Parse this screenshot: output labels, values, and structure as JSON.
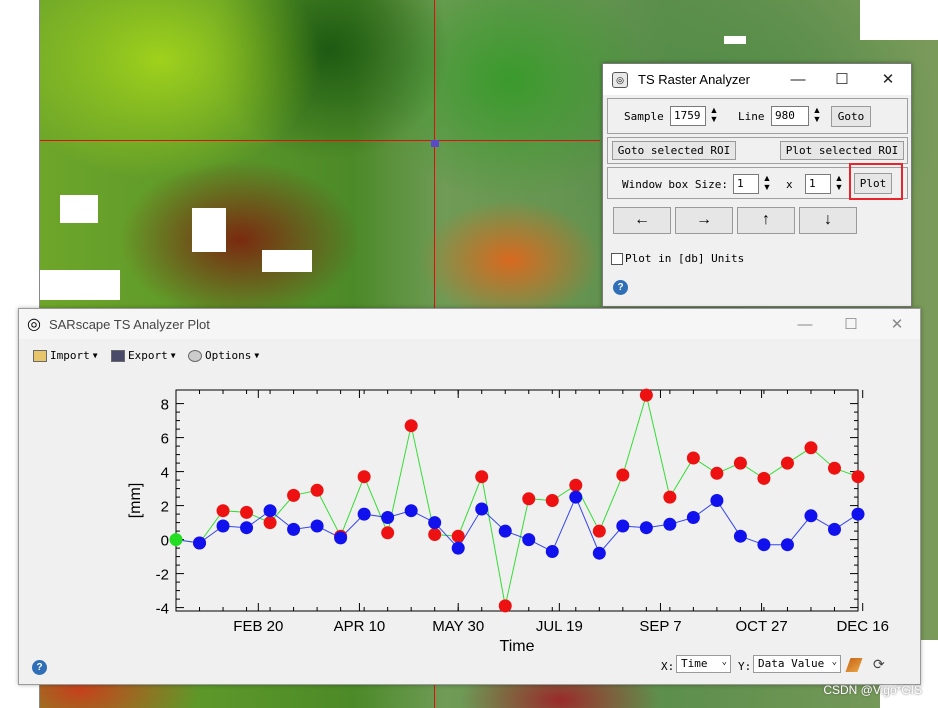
{
  "raster_window": {
    "description_hidden": ""
  },
  "ts_analyzer": {
    "title": "TS Raster Analyzer",
    "sample_label": "Sample",
    "sample_value": "1759",
    "line_label": "Line",
    "line_value": "980",
    "goto_label": "Goto",
    "goto_roi_label": "Goto selected ROI",
    "plot_roi_label": "Plot selected ROI",
    "window_box_label": "Window box Size:",
    "box_w": "1",
    "box_x": "x",
    "box_h": "1",
    "plot_label": "Plot",
    "db_units_label": "Plot in [db] Units",
    "arrows": [
      "←",
      "→",
      "↑",
      "↓"
    ],
    "help": "?"
  },
  "plot_window": {
    "title": "SARscape TS Analyzer Plot",
    "toolbar": {
      "import": "Import",
      "export": "Export",
      "options": "Options"
    },
    "x_axis_label_prefix": "X:",
    "x_select": "Time",
    "y_axis_label_prefix": "Y:",
    "y_select": "Data Value",
    "help": "?"
  },
  "chart_data": {
    "type": "line",
    "xlabel": "Time",
    "ylabel": "[mm]",
    "ylim": [
      -4.2,
      8.8
    ],
    "yticks": [
      8,
      6,
      4,
      2,
      0,
      -2,
      -4
    ],
    "xtick_labels": [
      "FEB 20",
      "APR 10",
      "MAY 30",
      "JUL 19",
      "SEP 7",
      "OCT 27",
      "DEC 16"
    ],
    "xtick_index": [
      3.5,
      7.8,
      12.0,
      16.3,
      20.6,
      24.9,
      29.2
    ],
    "n_points": 30,
    "series": [
      {
        "color": "#ee1111",
        "line_color": "#33dd33",
        "values": [
          -0.2,
          1.7,
          1.6,
          1.0,
          2.6,
          2.9,
          0.2,
          3.7,
          0.4,
          6.7,
          0.3,
          0.2,
          3.7,
          -3.9,
          2.4,
          2.3,
          3.2,
          0.5,
          3.8,
          8.5,
          2.5,
          4.8,
          3.9,
          4.5,
          3.6,
          4.5,
          5.4,
          4.2,
          3.7
        ]
      },
      {
        "color": "#1111ee",
        "line_color": "#3344ee",
        "values": [
          -0.2,
          0.8,
          0.7,
          1.7,
          0.6,
          0.8,
          0.1,
          1.5,
          1.3,
          1.7,
          1.0,
          -0.5,
          1.8,
          0.5,
          0.0,
          -0.7,
          2.5,
          -0.8,
          0.8,
          0.7,
          0.9,
          1.3,
          2.3,
          0.2,
          -0.3,
          -0.3,
          1.4,
          0.6,
          1.5
        ]
      }
    ],
    "start_point": {
      "value": 0.0,
      "color": "#22dd22"
    }
  },
  "watermark": "CSDN @Vigo*GIS"
}
